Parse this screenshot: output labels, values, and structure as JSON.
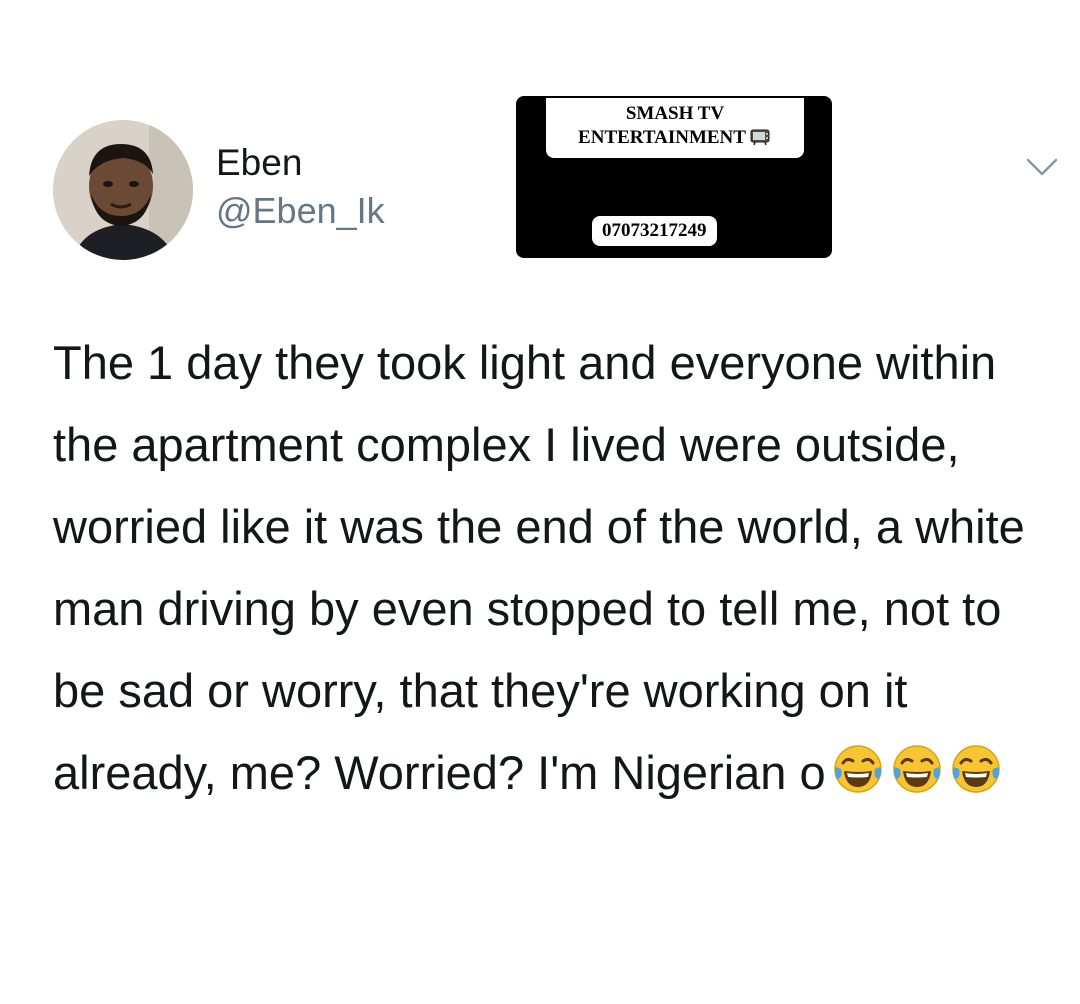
{
  "tweet": {
    "author": {
      "display_name": "Eben",
      "handle": "@Eben_Ik",
      "avatar_icon": "user-avatar"
    },
    "menu_icon": "chevron-down-icon",
    "text": "The 1 day they took light and everyone within the apartment complex I lived were outside, worried like it was the end of the world, a white man driving by even stopped to tell me, not to be sad or worry, that they're working on it already, me? Worried? I'm Nigerian o",
    "emojis": [
      "face-with-tears-of-joy",
      "face-with-tears-of-joy",
      "face-with-tears-of-joy"
    ]
  },
  "watermark": {
    "line1": "SMASH TV",
    "line2": "ENTERTAINMENT",
    "phone": "07073217249",
    "icon": "tv-icon"
  },
  "colors": {
    "text": "#14171a",
    "handle": "#657786",
    "watermark_bg": "#000000",
    "emoji_face": "#f7c533"
  }
}
